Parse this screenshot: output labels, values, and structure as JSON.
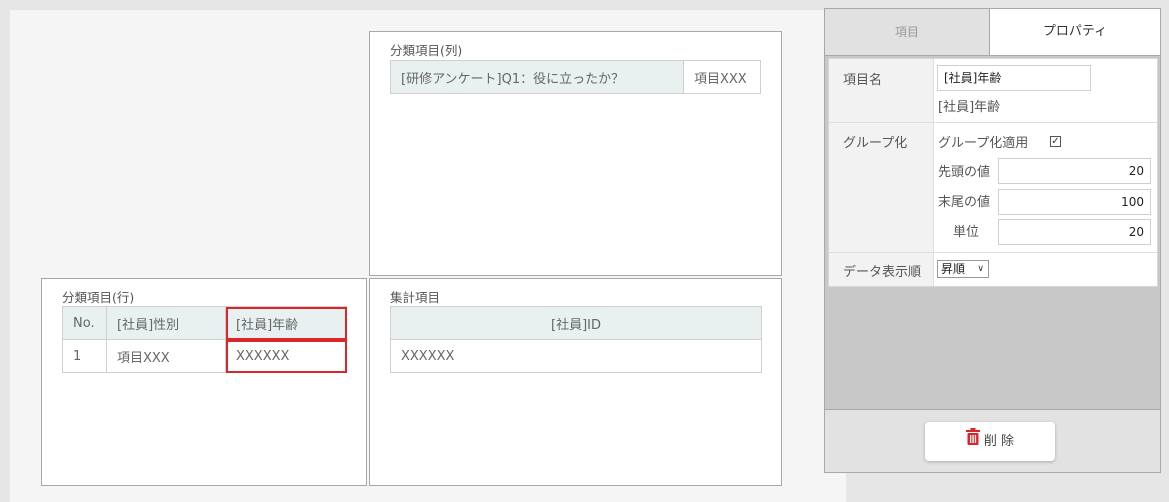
{
  "column_section": {
    "title": "分類項目(列)",
    "cells": [
      "[研修アンケート]Q1：役に立ったか？",
      "項目XXX"
    ]
  },
  "row_section": {
    "title": "分類項目(行)",
    "headers": [
      "No.",
      "[社員]性別",
      "[社員]年齢"
    ],
    "row": [
      "1",
      "項目XXX",
      "XXXXXX"
    ]
  },
  "aggregate_section": {
    "title": "集計項目",
    "header": "[社員]ID",
    "value": "XXXXXX"
  },
  "panel": {
    "tabs": {
      "items": "項目",
      "properties": "プロパティ"
    },
    "item_name": {
      "label": "項目名",
      "value": "[社員]年齢",
      "sub": "[社員]年齢"
    },
    "grouping": {
      "label": "グループ化",
      "apply_label": "グループ化適用",
      "apply_checked": true,
      "check_mark": "✓",
      "first_label": "先頭の値",
      "first_value": "20",
      "last_label": "末尾の値",
      "last_value": "100",
      "unit_label": "単位",
      "unit_value": "20"
    },
    "display_order": {
      "label": "データ表示順",
      "selected": "昇順"
    },
    "delete_label": "削 除",
    "colors": {
      "selected_outline": "#d9262b",
      "delete_icon": "#d9262b",
      "header_bg": "#e8f1f0"
    }
  }
}
